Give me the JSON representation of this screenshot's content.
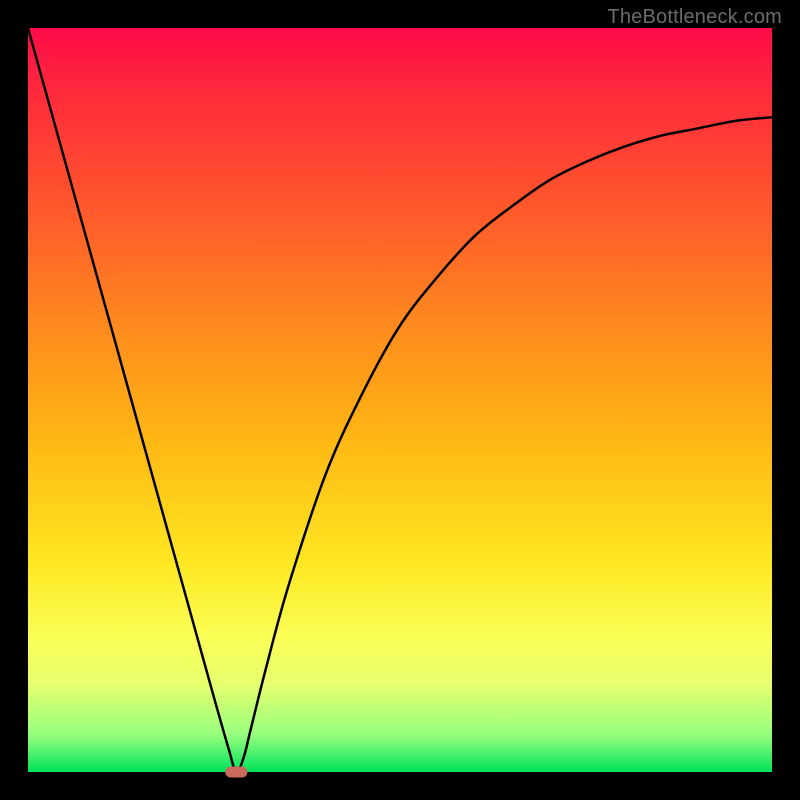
{
  "watermark": "TheBottleneck.com",
  "chart_data": {
    "type": "line",
    "title": "",
    "xlabel": "",
    "ylabel": "",
    "xlim": [
      0,
      100
    ],
    "ylim": [
      0,
      100
    ],
    "grid": false,
    "legend": false,
    "description": "Bottleneck percentage curve with a single minimum. Background gradient encodes severity (green=0 bottom, red=100 top).",
    "x": [
      0,
      5,
      10,
      15,
      20,
      25,
      27,
      28,
      29,
      30,
      32,
      35,
      40,
      45,
      50,
      55,
      60,
      65,
      70,
      75,
      80,
      85,
      90,
      95,
      100
    ],
    "y": [
      100,
      82,
      64,
      46,
      28,
      10,
      3,
      0,
      2,
      6,
      14,
      25,
      40,
      51,
      60,
      66.5,
      72,
      76,
      79.5,
      82,
      84,
      85.5,
      86.5,
      87.5,
      88
    ],
    "minimum_marker": {
      "x": 28,
      "y": 0
    },
    "gradient_stops": [
      {
        "pos": 0,
        "color": "#00e25a"
      },
      {
        "pos": 5,
        "color": "#97ff7e"
      },
      {
        "pos": 12,
        "color": "#e8ff6e"
      },
      {
        "pos": 18,
        "color": "#faff56"
      },
      {
        "pos": 28,
        "color": "#ffe822"
      },
      {
        "pos": 45,
        "color": "#ffb613"
      },
      {
        "pos": 60,
        "color": "#ff8a1e"
      },
      {
        "pos": 75,
        "color": "#ff5a2b"
      },
      {
        "pos": 90,
        "color": "#ff2e3a"
      },
      {
        "pos": 100,
        "color": "#ff0b48"
      }
    ]
  }
}
